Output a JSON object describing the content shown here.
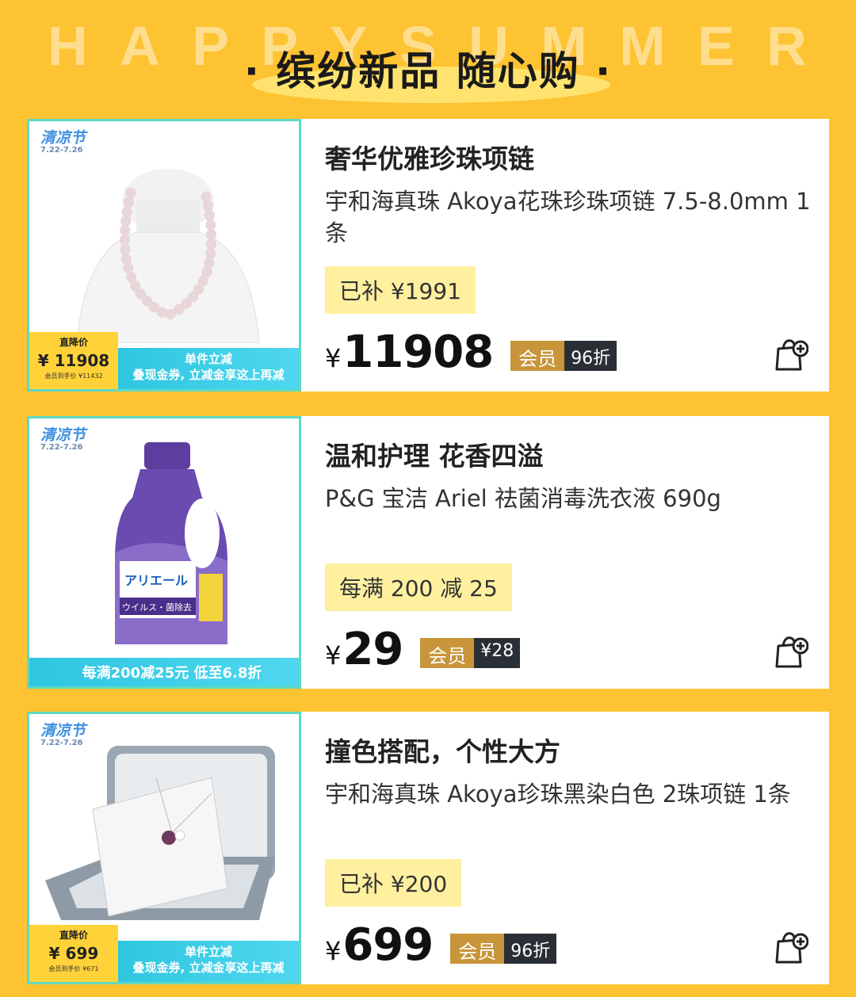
{
  "header": {
    "bg_letters": [
      "H",
      "A",
      "P",
      "P",
      "Y",
      "S",
      "U",
      "M",
      "M",
      "E",
      "R"
    ],
    "title": "· 缤纷新品  随心购 ·"
  },
  "products": [
    {
      "thumb": {
        "festival": "清凉节",
        "festival_date": "7.22-7.26",
        "product_icon": "pearl-necklace-bust",
        "price_tag_title": "直降价",
        "price_tag_price": "¥ 11908",
        "price_tag_member": "会员到手价 ¥11432",
        "ribbon_line1": "单件立减",
        "ribbon_line2": "叠现金券, 立减金享这上再减"
      },
      "headline": "奢华优雅珍珠项链",
      "description": "宇和海真珠 Akoya花珠珍珠项链 7.5-8.0mm 1条",
      "promo": "已补 ¥1991",
      "yen": "¥",
      "price": "11908",
      "member_label": "会员",
      "member_value": "96折"
    },
    {
      "thumb": {
        "festival": "清凉节",
        "festival_date": "7.22-7.26",
        "product_icon": "detergent-bottle",
        "bottle_label": "アリエール",
        "bottle_sublabel": "ウイルス・菌除去",
        "ribbon_full": "每满200减25元 低至6.8折"
      },
      "headline": "温和护理 花香四溢",
      "description": "P&G 宝洁 Ariel 祛菌消毒洗衣液 690g",
      "promo": "每满 200 减 25",
      "yen": "¥",
      "price": "29",
      "member_label": "会员",
      "member_value": "¥28"
    },
    {
      "thumb": {
        "festival": "清凉节",
        "festival_date": "7.22-7.26",
        "product_icon": "pendant-gift-box",
        "price_tag_title": "直降价",
        "price_tag_price": "¥ 699",
        "price_tag_member": "会员到手价 ¥671",
        "ribbon_line1": "单件立减",
        "ribbon_line2": "叠现金券, 立减金享这上再减"
      },
      "headline": "撞色搭配，个性大方",
      "description": "宇和海真珠 Akoya珍珠黑染白色 2珠项链 1条",
      "promo": "已补 ¥200",
      "yen": "¥",
      "price": "699",
      "member_label": "会员",
      "member_value": "96折"
    }
  ],
  "colors": {
    "background": "#FDC332",
    "promo_bg": "#FFF0A0",
    "member_gold": "#C8953A",
    "member_dark": "#2A2F35",
    "thumb_border": "#5FD9C2"
  }
}
